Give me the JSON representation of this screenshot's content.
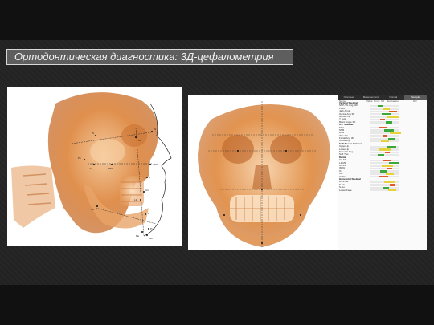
{
  "slide": {
    "title": "Ортодонтическая диагностика: 3Д-цефалометрия"
  },
  "lateral_view": {
    "landmarks": [
      "N",
      "Or",
      "Po",
      "Ar",
      "Go",
      "Me",
      "Pog",
      "A",
      "B",
      "ANS",
      "PNS",
      "S",
      "Gn",
      "U1",
      "L1"
    ]
  },
  "analysis_table": {
    "tabs": [
      "Overview",
      "Measurements",
      "Normal",
      "Sample"
    ],
    "active_tab": "Sample",
    "columns": [
      "Name",
      "Value",
      "Norm",
      "SD",
      "Evaluation",
      "Diff"
    ],
    "groups": [
      {
        "name": "Vertical Skeletal",
        "rows": [
          "SNP-SN Ang_3D",
          "FMIA",
          "Jarb Angle",
          "Gonial Ang 3D",
          "Ramus Ht",
          "Y axis",
          "Basic Angle 3D"
        ]
      },
      {
        "name": "A-P Skeletal",
        "rows": [
          "SNA",
          "SNB",
          "ANB",
          "Wits 3D",
          "Facial Ang 3D",
          "Convexity"
        ]
      },
      {
        "name": "Soft Tissue Intersec.",
        "rows": [
          "UpperLip",
          "LowerLip",
          "Nasolab Ang",
          "Soft Tiss"
        ]
      },
      {
        "name": "Dental",
        "rows": [
          "U1-SN",
          "L1-MP",
          "U1-L1",
          "IMPA",
          "OJ",
          "OB",
          "Ovbite"
        ]
      },
      {
        "name": "Horizontal Skeletal",
        "rows": [
          "ANS-Me",
          "N-Me",
          "S-Go",
          "Lower Face"
        ]
      }
    ]
  },
  "colors": {
    "scan_orange": "#d9833f",
    "panel_bg": "#ffffff",
    "title_bg": "#5e5e5e"
  }
}
